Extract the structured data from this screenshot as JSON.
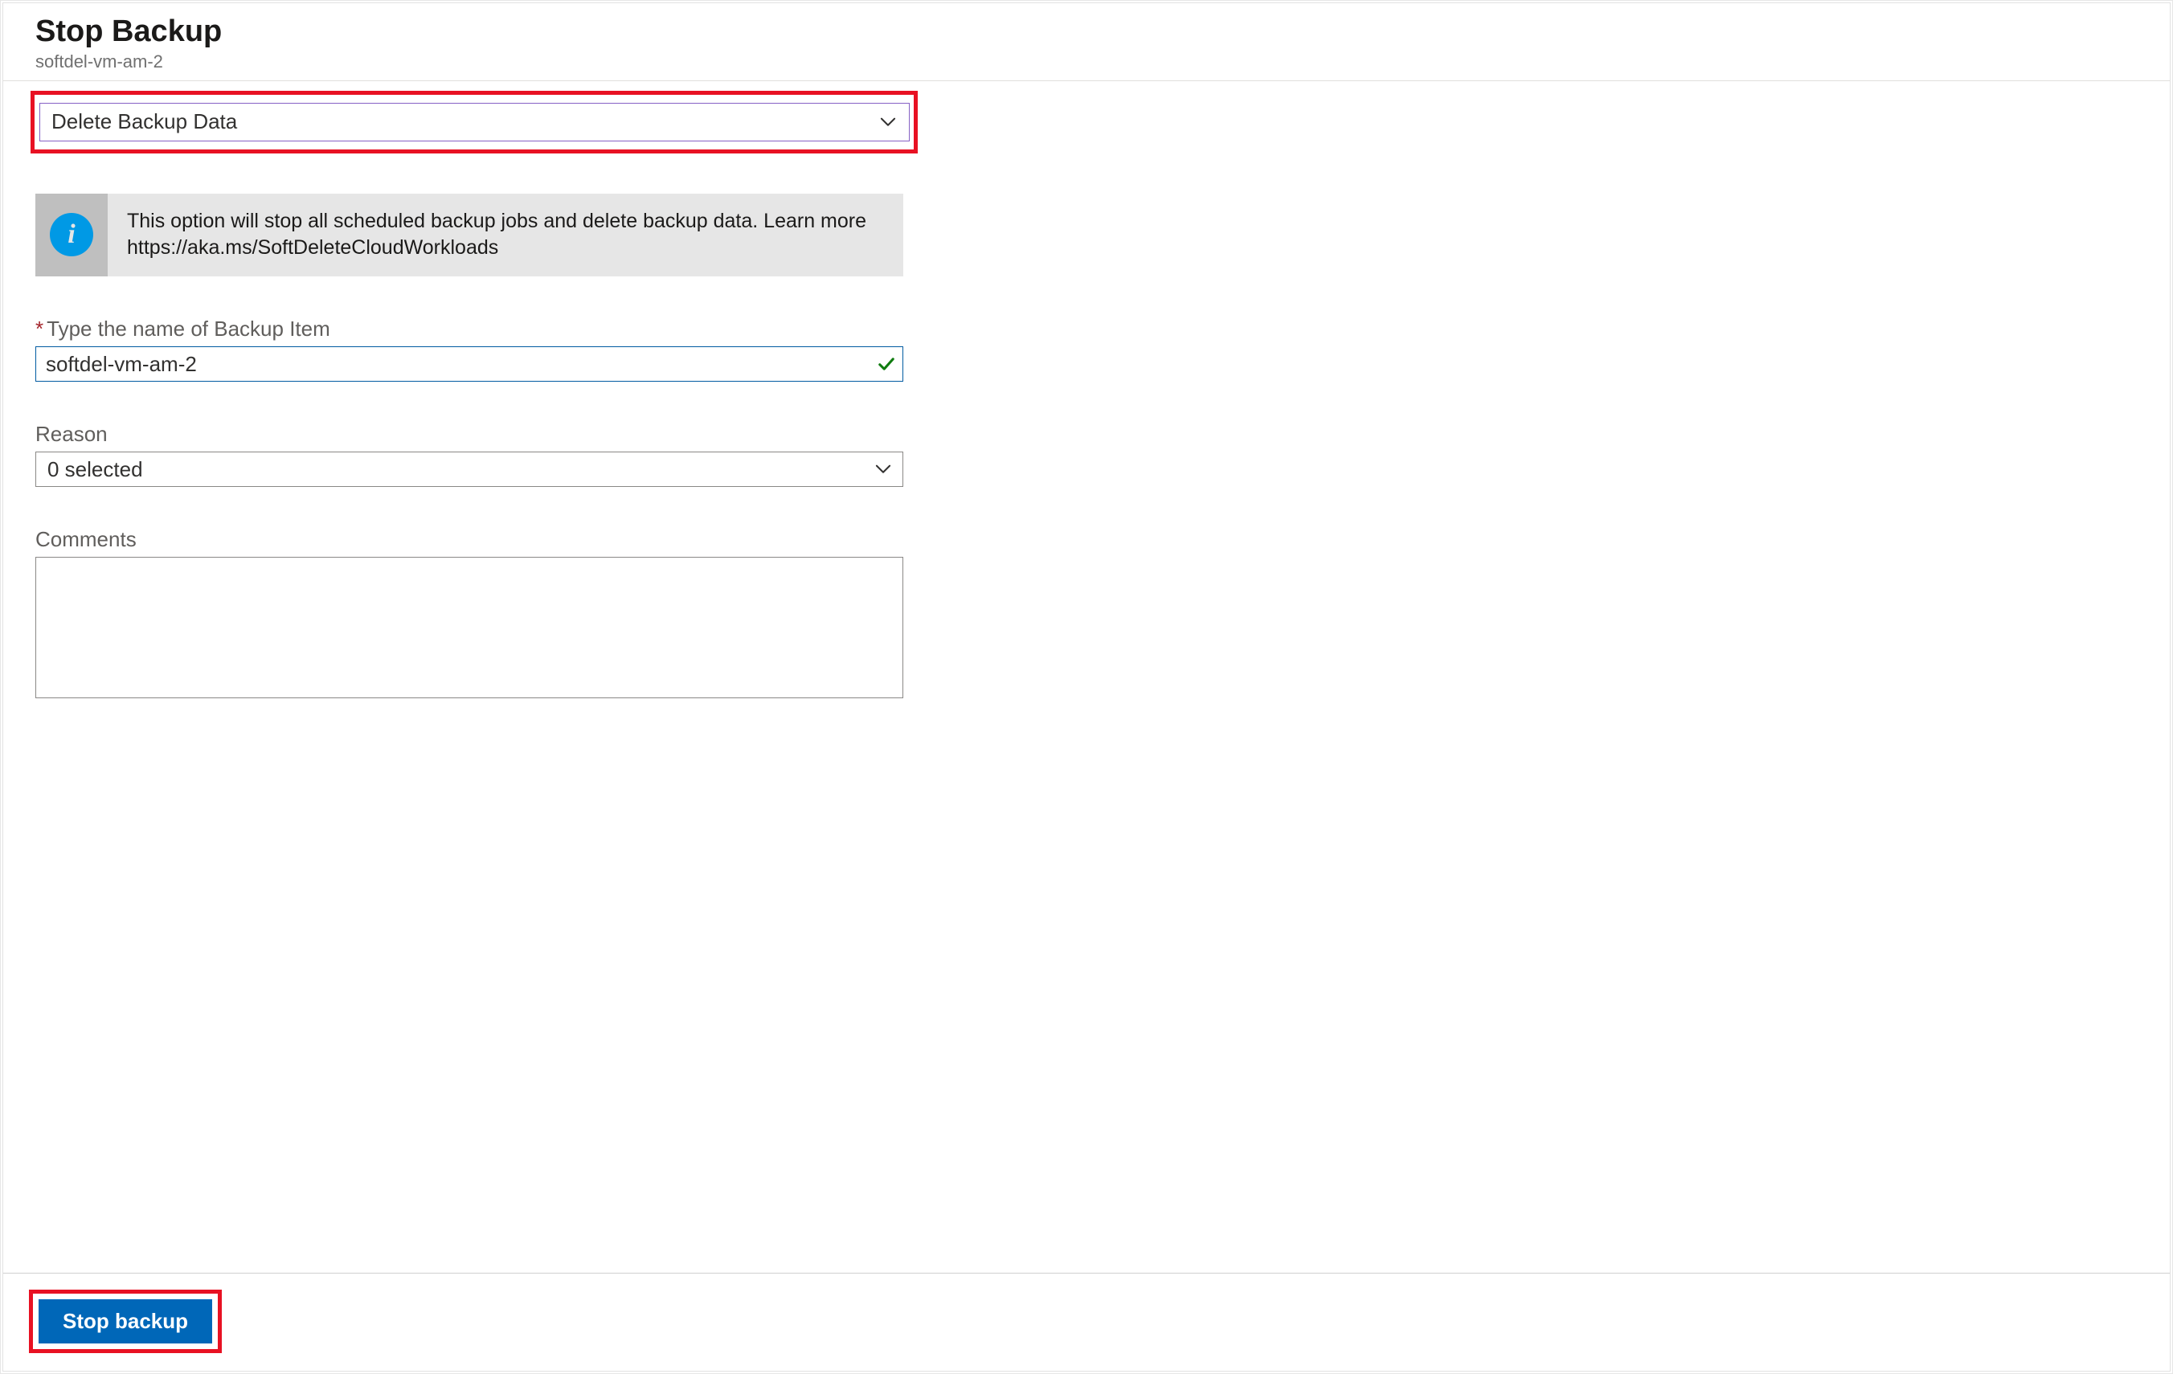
{
  "header": {
    "title": "Stop Backup",
    "subtitle": "softdel-vm-am-2"
  },
  "action_dropdown": {
    "selected": "Delete Backup Data"
  },
  "info": {
    "text_line1": "This option will stop all scheduled backup jobs and delete backup data. Learn more",
    "text_line2": "https://aka.ms/SoftDeleteCloudWorkloads"
  },
  "fields": {
    "name_label": "Type the name of Backup Item",
    "name_value": "softdel-vm-am-2",
    "reason_label": "Reason",
    "reason_value": "0 selected",
    "comments_label": "Comments",
    "comments_value": ""
  },
  "footer": {
    "button": "Stop backup"
  }
}
